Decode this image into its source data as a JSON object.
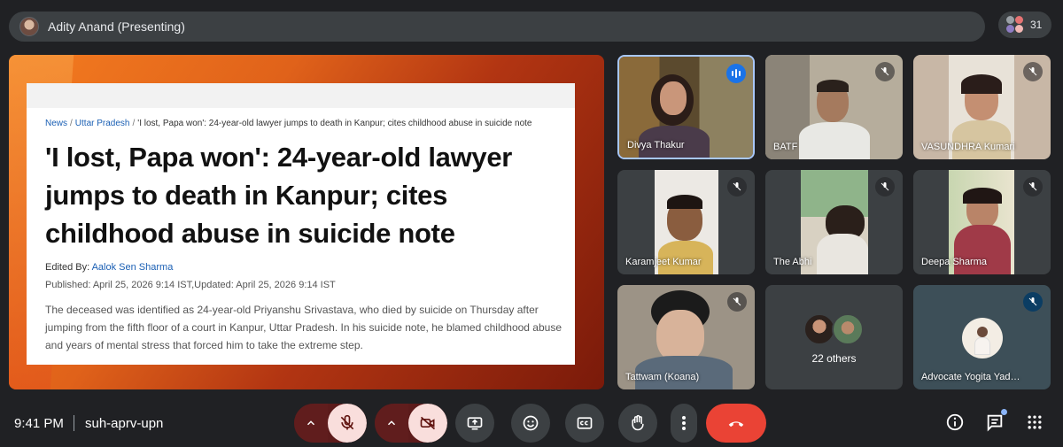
{
  "top_bar": {
    "presenter": "Adity Anand (Presenting)",
    "participant_count": "31"
  },
  "presentation": {
    "breadcrumb": {
      "home": "News",
      "section": "Uttar Pradesh",
      "current": "'I lost, Papa won': 24-year-old lawyer jumps to death in Kanpur; cites childhood abuse in suicide note"
    },
    "headline": "'I lost, Papa won': 24-year-old lawyer jumps to death in Kanpur; cites childhood abuse in suicide note",
    "edited_by_label": "Edited By:",
    "edited_by_name": "Aalok Sen Sharma",
    "published": "Published: April 25, 2026 9:14 IST,Updated: April 25, 2026 9:14 IST",
    "body": "The deceased was identified as 24-year-old Priyanshu Srivastava, who died by suicide on Thursday after jumping from the fifth floor of a court in Kanpur, Uttar Pradesh. In his suicide note, he blamed childhood abuse and years of mental stress that forced him to take the extreme step."
  },
  "participants": [
    {
      "name": "Divya Thakur",
      "status": "speaking"
    },
    {
      "name": "BATF",
      "status": "muted"
    },
    {
      "name": "VASUNDHRA Kumari",
      "status": "muted"
    },
    {
      "name": "Karamjeet Kumar",
      "status": "muted"
    },
    {
      "name": "The Abhi",
      "status": "muted"
    },
    {
      "name": "Deepa Sharma",
      "status": "muted"
    },
    {
      "name": "Tattwam (Koana)",
      "status": "muted"
    },
    {
      "name": "22 others",
      "status": "group"
    },
    {
      "name": "Advocate Yogita Yad…",
      "status": "muted"
    }
  ],
  "bottom_bar": {
    "time": "9:41 PM",
    "meeting_code": "suh-aprv-upn"
  },
  "colors": {
    "background": "#202124",
    "surface": "#3c4043",
    "hangup": "#ea4335",
    "muted_control": "#f9dedc",
    "active_speaker": "#a8c7fa"
  },
  "icons": [
    "mic-off-icon",
    "camera-off-icon",
    "present-icon",
    "emoji-icon",
    "captions-icon",
    "raise-hand-icon",
    "more-icon",
    "call-end-icon",
    "info-icon",
    "chat-icon",
    "activities-icon"
  ]
}
